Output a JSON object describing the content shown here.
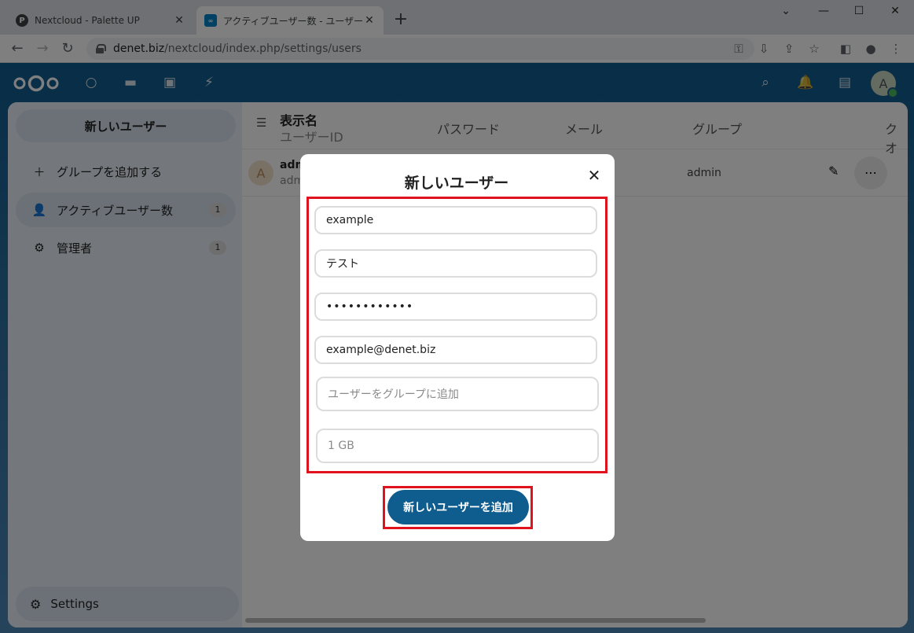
{
  "browser": {
    "tabs": [
      {
        "title": "Nextcloud - Palette UP",
        "favicon": "P"
      },
      {
        "title": "アクティブユーザー数 - ユーザー - ユーザー",
        "favicon": "∞"
      }
    ],
    "url_host": "denet.biz",
    "url_path": "/nextcloud/index.php/settings/users"
  },
  "sidebar": {
    "new_user_label": "新しいユーザー",
    "items": [
      {
        "label": "グループを追加する",
        "icon": "plus-icon",
        "count": ""
      },
      {
        "label": "アクティブユーザー数",
        "icon": "users-icon",
        "count": "1"
      },
      {
        "label": "管理者",
        "icon": "admin-gear-icon",
        "count": "1"
      }
    ],
    "settings_label": "Settings"
  },
  "table": {
    "header": {
      "display_name": "表示名",
      "user_id": "ユーザーID",
      "password": "パスワード",
      "email": "メール",
      "groups": "グループ",
      "quota": "クオ"
    },
    "rows": [
      {
        "avatar": "A",
        "display_name": "adm",
        "user_id": "adm",
        "groups": "admin"
      }
    ]
  },
  "topbar": {
    "avatar": "A"
  },
  "modal": {
    "title": "新しいユーザー",
    "fields": {
      "username": "example",
      "display_name": "テスト",
      "password": "••••••••••••",
      "email": "example@denet.biz",
      "groups_placeholder": "ユーザーをグループに追加",
      "quota_placeholder": "1 GB"
    },
    "submit_label": "新しいユーザーを追加"
  },
  "colors": {
    "primary": "#0f5c8f",
    "highlight": "#e0121d"
  }
}
